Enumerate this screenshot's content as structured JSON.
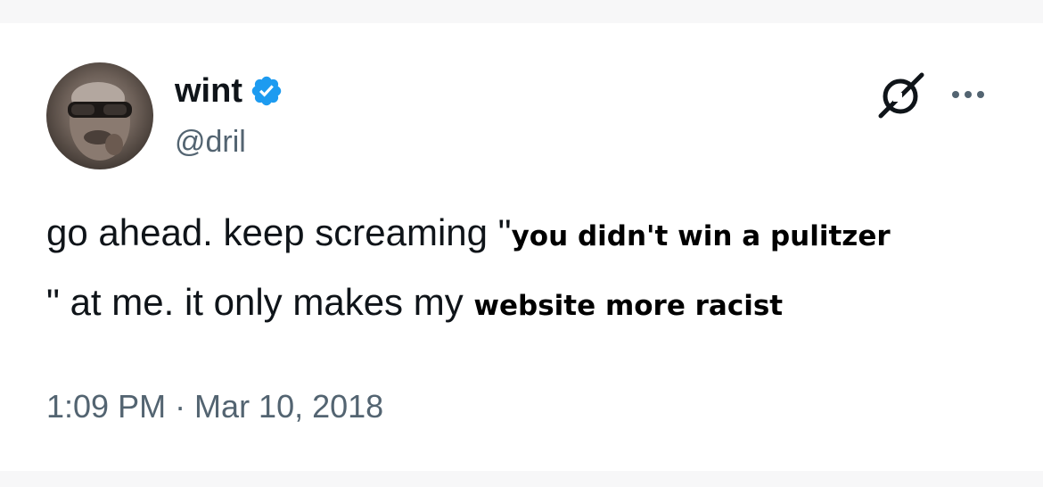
{
  "author": {
    "display_name": "wint",
    "handle": "@dril",
    "verified": true,
    "verified_color": "#1d9bf0"
  },
  "icons": {
    "grok": "grok-icon",
    "more": "more-dots-icon",
    "verified": "verified-badge-icon"
  },
  "tweet": {
    "line1_prefix": "go ahead. keep screaming \"",
    "line1_insert": "you didn't win a pulitzer",
    "line2_prefix": "\" at me. it only makes my ",
    "line2_insert": "website more racist"
  },
  "timestamp": "1:09 PM · Mar 10, 2018",
  "colors": {
    "text_primary": "#0f1419",
    "text_secondary": "#536471",
    "background": "#ffffff"
  }
}
